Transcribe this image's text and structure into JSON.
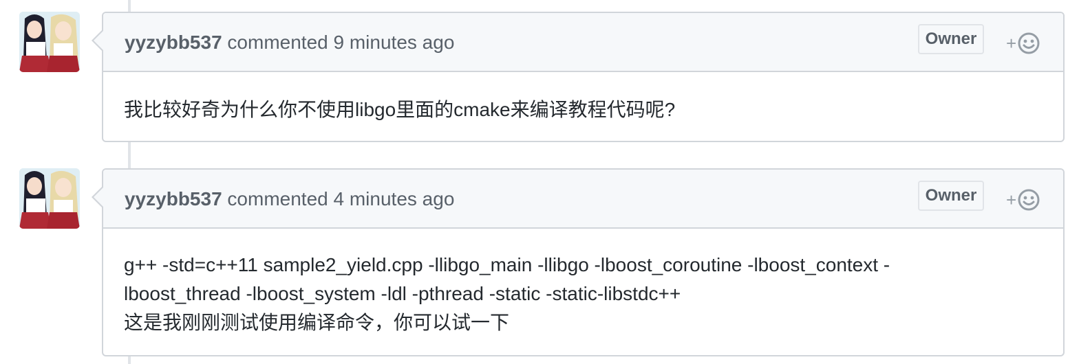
{
  "comments": [
    {
      "author": "yyzybb537",
      "action": "commented",
      "time": "9 minutes ago",
      "badge": "Owner",
      "reaction_plus": "+",
      "body": [
        "我比较好奇为什么你不使用libgo里面的cmake来编译教程代码呢?"
      ]
    },
    {
      "author": "yyzybb537",
      "action": "commented",
      "time": "4 minutes ago",
      "badge": "Owner",
      "reaction_plus": "+",
      "body": [
        "g++ -std=c++11 sample2_yield.cpp -llibgo_main -llibgo -lboost_coroutine -lboost_context -",
        "lboost_thread -lboost_system -ldl -pthread -static -static-libstdc++",
        "这是我刚刚测试使用编译命令，你可以试一下"
      ]
    }
  ],
  "icons": {
    "avatar": "anime-avatar",
    "reaction": "smiley-icon"
  },
  "colors": {
    "header_bg": "#f6f8fa",
    "border": "#d1d5da",
    "muted_text": "#586069",
    "body_text": "#24292e"
  }
}
